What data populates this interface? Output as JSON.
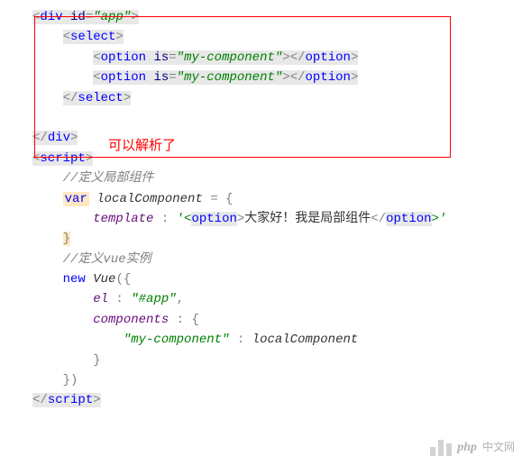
{
  "code": {
    "div_open_lt": "<",
    "div_tag": "div",
    "id_attr": "id",
    "eq": "=",
    "app_val": "\"app\"",
    "gt": ">",
    "select_tag": "select",
    "option_tag": "option",
    "is_attr": "is",
    "component_val": "\"my-component\"",
    "close_lt": "</",
    "script_tag": "script",
    "comment1": "//定义局部组件",
    "var_kw": "var",
    "local_comp": "localComponent",
    "assign": " = {",
    "template_prop": "template",
    "colon": " : ",
    "template_str_open": "'<",
    "template_str_text": "大家好！我是局部组件",
    "template_str_close": ">'",
    "close_brace": "}",
    "comment2": "//定义vue实例",
    "new_kw": "new",
    "vue_ident": "Vue",
    "paren_brace": "({",
    "el_prop": "el",
    "el_val": "\"#app\"",
    "comma": ",",
    "components_prop": "components",
    "brace_open": " : {",
    "comp_key": "\"my-component\"",
    "close_paren_brace": "})"
  },
  "annotation": "可以解析了",
  "watermark": {
    "php": "php",
    "text": "中文网"
  }
}
